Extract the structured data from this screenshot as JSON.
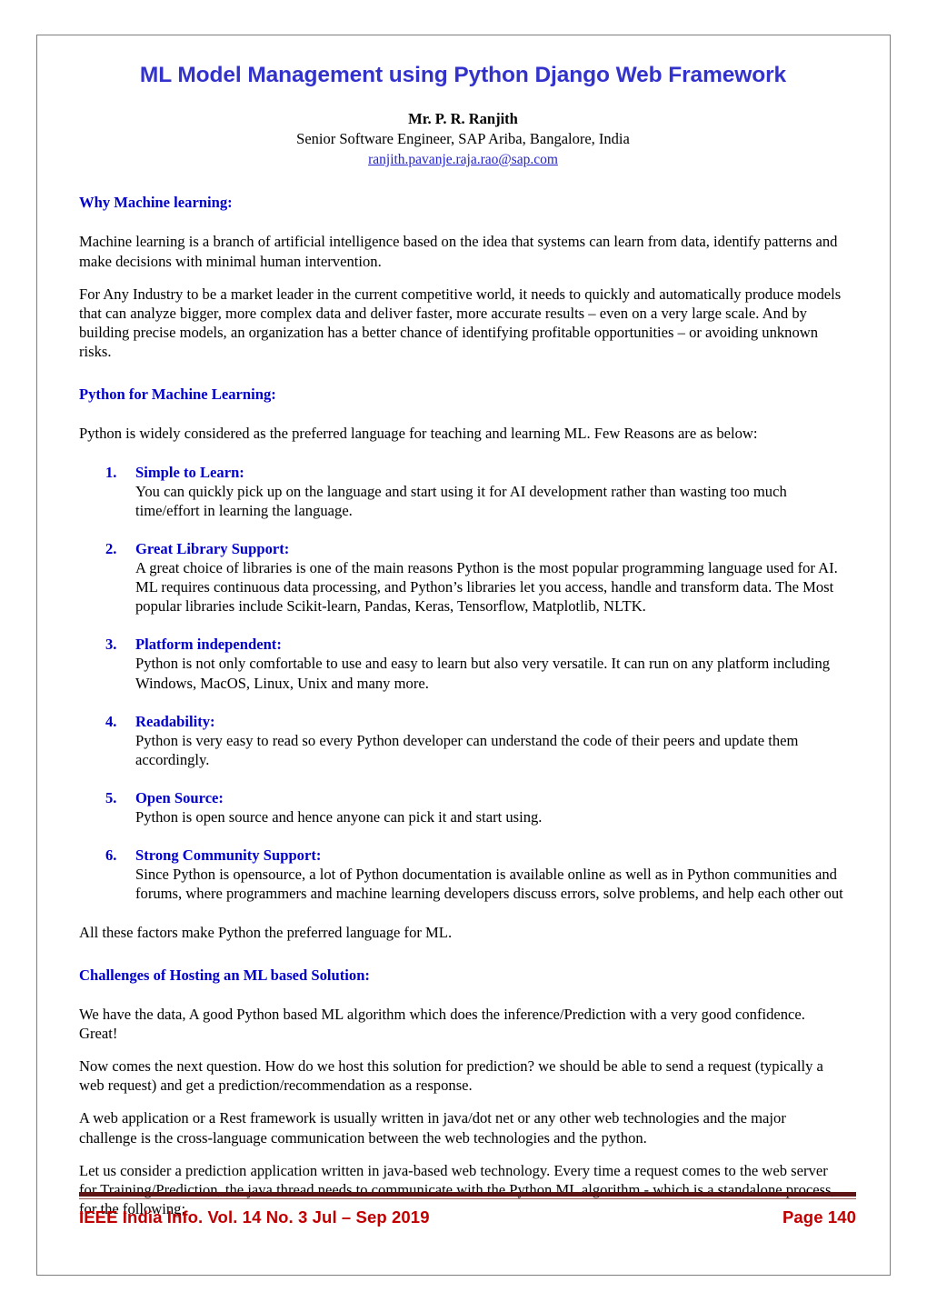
{
  "document": {
    "title": "ML Model Management using Python Django Web Framework",
    "author": {
      "name": "Mr. P. R. Ranjith",
      "affiliation": "Senior Software Engineer, SAP Ariba, Bangalore, India",
      "email": "ranjith.pavanje.raja.rao@sap.com"
    },
    "colors": {
      "title_blue": "#3333CC",
      "heading_blue": "#0000CC",
      "link_blue": "#2222CC",
      "footer_red": "#C00000",
      "footer_rule_maroon": "#5E1414",
      "page_border_gray": "#7F7F7F",
      "body_text": "#000000"
    },
    "sections": {
      "why_ml": {
        "heading": "Why Machine learning:",
        "paragraphs": [
          "Machine learning is a branch of artificial intelligence based on the idea that systems can learn from data, identify patterns and make decisions with minimal human intervention.",
          "For Any Industry to be a market leader in the current competitive world, it needs to quickly and automatically produce models that can analyze bigger, more complex data and deliver faster, more accurate results – even on a very large scale. And by building precise models, an organization has a better chance of identifying profitable opportunities – or avoiding unknown risks."
        ]
      },
      "python_for_ml": {
        "heading": "Python for Machine Learning:",
        "intro": "Python is widely considered as the preferred language for teaching and learning ML. Few Reasons are as below:",
        "reasons": [
          {
            "number": "1.",
            "title": "Simple to Learn:",
            "text": "You can quickly pick up on the language and start using it for AI development rather than wasting too much time/effort in learning the language."
          },
          {
            "number": "2.",
            "title": "Great Library Support:",
            "text": "A great choice of libraries is one of the main reasons Python is the most popular programming language used for AI. ML requires continuous data processing, and Python’s libraries let you access, handle and transform data. The Most popular libraries include Scikit-learn, Pandas, Keras, Tensorflow, Matplotlib, NLTK."
          },
          {
            "number": "3.",
            "title": "Platform independent:",
            "text": "Python is not only comfortable to use and easy to learn but also very versatile. It can run on any platform including Windows, MacOS, Linux, Unix and many more."
          },
          {
            "number": "4.",
            "title": "Readability:",
            "text": "Python is very easy to read so every Python developer can understand the code of their peers and update them accordingly."
          },
          {
            "number": "5.",
            "title": "Open Source:",
            "text": "Python is open source and hence anyone can pick it and start using."
          },
          {
            "number": "6.",
            "title": "Strong Community Support:",
            "text": "Since Python is opensource, a lot of Python documentation is available online as well as in Python communities and forums, where programmers and machine learning developers discuss errors, solve problems, and help each other out"
          }
        ],
        "closing": "All these factors make Python the preferred language for ML."
      },
      "challenges": {
        "heading": "Challenges of Hosting an ML based Solution:",
        "paragraphs": [
          "We have the data, A good Python based ML algorithm which does the inference/Prediction with a very good confidence. Great!",
          "Now comes the next question. How do we host this solution for prediction? we should be able to send a request (typically a web request) and get a prediction/recommendation as a response.",
          "A web application or a Rest framework is usually written in java/dot net or any other web technologies and the major challenge is the cross-language communication between the web technologies and the python.",
          "Let us consider a prediction application written in java-based web technology. Every time a request comes to the web server for Training/Prediction, the java thread needs to communicate with the Python ML algorithm - which is a standalone process, for the following:"
        ]
      }
    },
    "footer": {
      "left": "IEEE India Info. Vol. 14   No. 3  Jul – Sep 2019",
      "right": "Page 140"
    }
  }
}
